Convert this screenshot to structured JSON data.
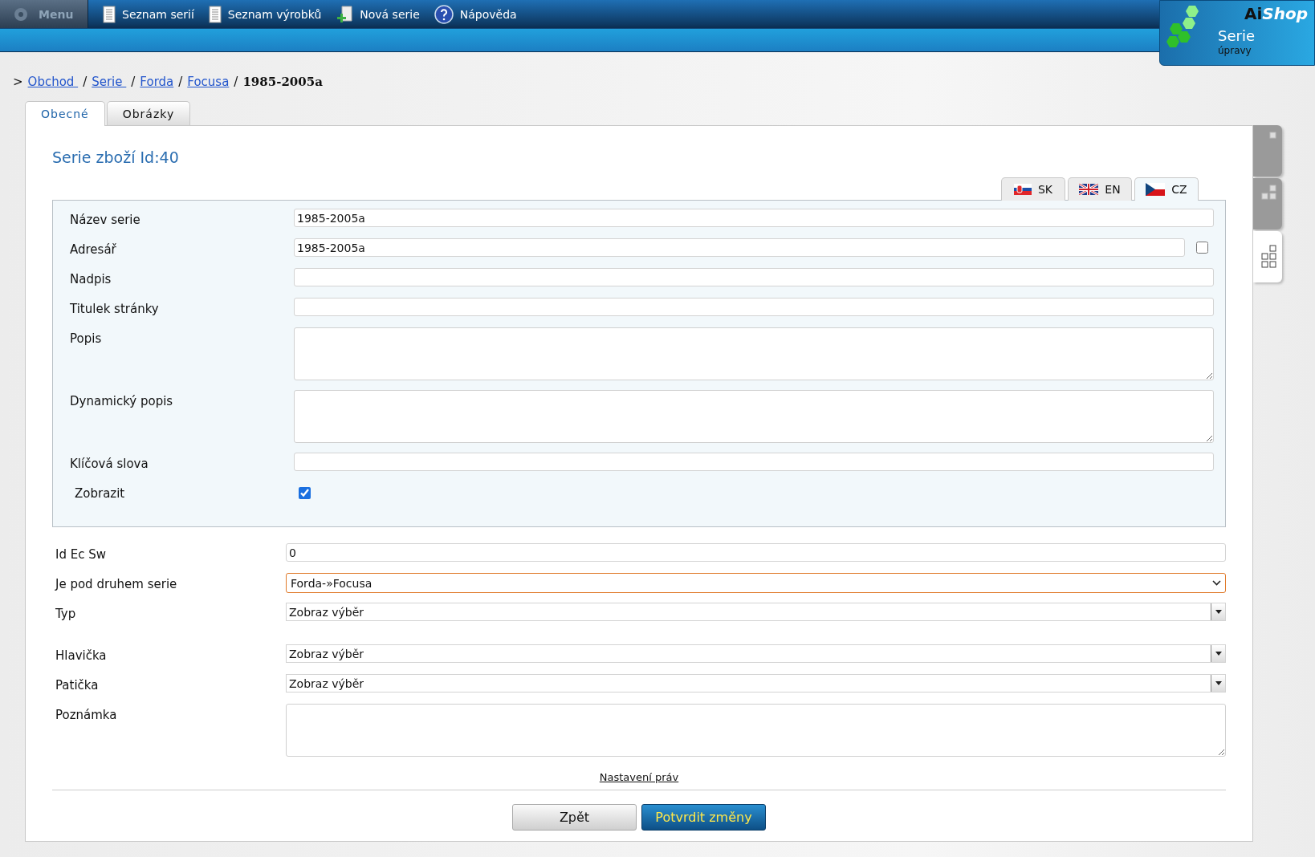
{
  "top_bar": {
    "menu": "Menu",
    "items": [
      {
        "label": "Seznam serií",
        "kind": "list"
      },
      {
        "label": "Seznam výrobků",
        "kind": "list"
      },
      {
        "label": "Nová serie",
        "kind": "new"
      },
      {
        "label": "Nápověda",
        "kind": "help"
      }
    ]
  },
  "logo": {
    "brand_plain": "Ai",
    "brand_italic": "Shop",
    "title": "Serie",
    "subtitle": "úpravy"
  },
  "breadcrumb": {
    "lead": ">",
    "links": [
      {
        "text": "Obchod ",
        "separator": "/"
      },
      {
        "text": "Serie ",
        "separator": "/"
      },
      {
        "text": "Forda",
        "separator": "/"
      },
      {
        "text": "Focusa",
        "separator": "/"
      }
    ],
    "current": "1985-2005a"
  },
  "tabs": [
    {
      "label": "Obecné",
      "selected": true
    },
    {
      "label": "Obrázky",
      "selected": false
    }
  ],
  "side_tabs": [
    {
      "kind": "one",
      "selected": false
    },
    {
      "kind": "three",
      "selected": false
    },
    {
      "kind": "five",
      "selected": true
    }
  ],
  "heading": "Serie zboží Id:40",
  "lang_tabs": [
    {
      "label": "SK",
      "kind": "sk",
      "selected": false
    },
    {
      "label": "EN",
      "kind": "en",
      "selected": false
    },
    {
      "label": "CZ",
      "kind": "cz",
      "selected": true
    }
  ],
  "localized_fields": [
    {
      "label": "Název serie",
      "kind": "text",
      "value": "1985-2005a"
    },
    {
      "label": "Adresář",
      "kind": "text",
      "value": "1985-2005a",
      "checked": false
    },
    {
      "label": "Nadpis",
      "kind": "text"
    },
    {
      "label": "Titulek stránky",
      "kind": "text"
    },
    {
      "label": "Popis",
      "kind": "textarea"
    },
    {
      "label": "Dynamický popis",
      "kind": "textarea"
    },
    {
      "label": "Klíčová slova",
      "kind": "text"
    },
    {
      "label": "Zobrazit",
      "kind": "checkbox",
      "checked": true
    }
  ],
  "general_fields": [
    {
      "label": "Id Ec Sw",
      "kind": "text",
      "value": "0"
    },
    {
      "label": "Je pod druhem serie",
      "kind": "select",
      "value": "Forda-»Focusa",
      "focused": true
    },
    {
      "label": "Typ",
      "kind": "dropdown",
      "value": "Zobraz výběr"
    }
  ],
  "template_fields": [
    {
      "label": "Hlavička",
      "kind": "dropdown",
      "value": "Zobraz výběr"
    },
    {
      "label": "Patička",
      "kind": "dropdown",
      "value": "Zobraz výběr"
    },
    {
      "label": "Poznámka",
      "kind": "textarea"
    }
  ],
  "rights_link": "Nastavení práv",
  "buttons": [
    {
      "label": "Zpět",
      "kind": "secondary"
    },
    {
      "label": "Potvrdit změny",
      "kind": "primary"
    }
  ]
}
